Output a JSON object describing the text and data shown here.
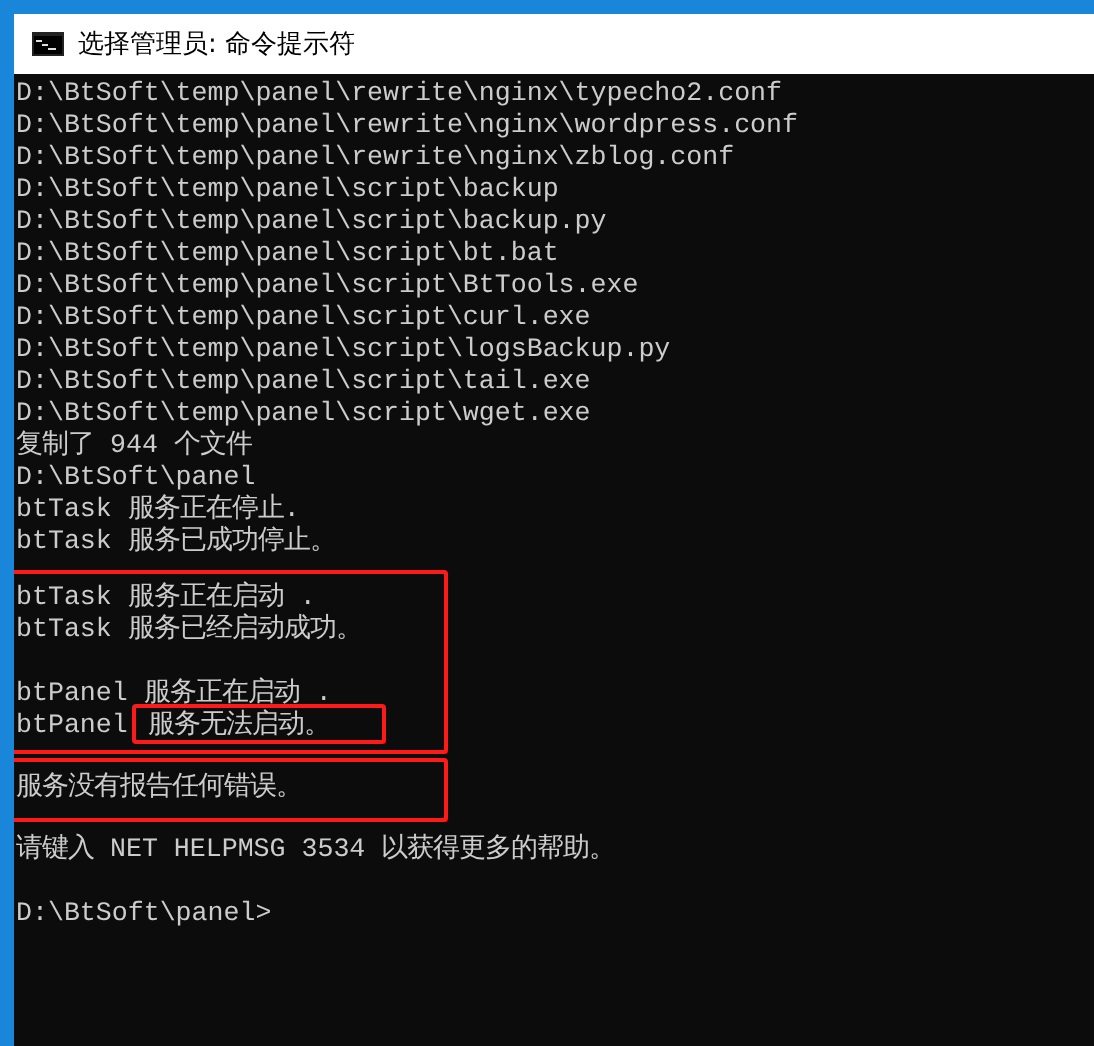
{
  "window": {
    "title": "选择管理员: 命令提示符"
  },
  "console": {
    "blocks": [
      {
        "highlighted": false,
        "lines": [
          {
            "kind": "text",
            "text": "D:\\BtSoft\\temp\\panel\\rewrite\\nginx\\typecho2.conf"
          },
          {
            "kind": "text",
            "text": "D:\\BtSoft\\temp\\panel\\rewrite\\nginx\\wordpress.conf"
          },
          {
            "kind": "text",
            "text": "D:\\BtSoft\\temp\\panel\\rewrite\\nginx\\zblog.conf"
          },
          {
            "kind": "text",
            "text": "D:\\BtSoft\\temp\\panel\\script\\backup"
          },
          {
            "kind": "text",
            "text": "D:\\BtSoft\\temp\\panel\\script\\backup.py"
          },
          {
            "kind": "text",
            "text": "D:\\BtSoft\\temp\\panel\\script\\bt.bat"
          },
          {
            "kind": "text",
            "text": "D:\\BtSoft\\temp\\panel\\script\\BtTools.exe"
          },
          {
            "kind": "text",
            "text": "D:\\BtSoft\\temp\\panel\\script\\curl.exe"
          },
          {
            "kind": "text",
            "text": "D:\\BtSoft\\temp\\panel\\script\\logsBackup.py"
          },
          {
            "kind": "text",
            "text": "D:\\BtSoft\\temp\\panel\\script\\tail.exe"
          },
          {
            "kind": "text",
            "text": "D:\\BtSoft\\temp\\panel\\script\\wget.exe"
          },
          {
            "kind": "text",
            "text": "复制了 944 个文件"
          },
          {
            "kind": "text",
            "text": "D:\\BtSoft\\panel"
          },
          {
            "kind": "text",
            "text": "btTask 服务正在停止."
          },
          {
            "kind": "text",
            "text": "btTask 服务已成功停止。"
          }
        ]
      },
      {
        "highlighted": true,
        "lines": [
          {
            "kind": "text",
            "text": "btTask 服务正在启动 ."
          },
          {
            "kind": "text",
            "text": "btTask 服务已经启动成功。"
          },
          {
            "kind": "blank"
          },
          {
            "kind": "text",
            "text": "btPanel 服务正在启动 ."
          },
          {
            "kind": "split",
            "parts": [
              {
                "text": "btPanel",
                "highlighted": false
              },
              {
                "text": "服务无法启动。",
                "highlighted": true
              }
            ]
          }
        ]
      },
      {
        "highlighted": true,
        "lines": [
          {
            "kind": "text",
            "text": "服务没有报告任何错误。"
          }
        ]
      },
      {
        "highlighted": false,
        "lines": [
          {
            "kind": "text",
            "text": "请键入 NET HELPMSG 3534 以获得更多的帮助。"
          },
          {
            "kind": "blank"
          },
          {
            "kind": "text",
            "text": "D:\\BtSoft\\panel>"
          }
        ]
      }
    ]
  }
}
